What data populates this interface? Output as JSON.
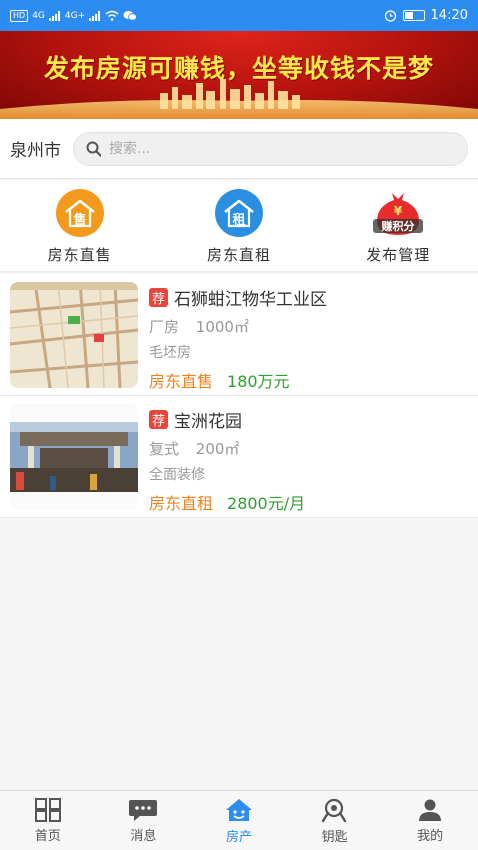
{
  "status_bar": {
    "time": "14:20",
    "network_a": "4G",
    "network_b": "4G+",
    "hd": "HD"
  },
  "banner": {
    "text": "发布房源可赚钱，坐等收钱不是梦"
  },
  "search": {
    "city": "泉州市",
    "placeholder": "搜索..."
  },
  "quick_nav": [
    {
      "label": "房东直售",
      "glyph": "售",
      "icon": "house-sale-icon",
      "color": "#f39a1c"
    },
    {
      "label": "房东直租",
      "glyph": "租",
      "icon": "house-rent-icon",
      "color": "#2a8fe0"
    },
    {
      "label": "发布管理",
      "glyph": "赚积分",
      "icon": "money-bag-icon",
      "color": "#e82b2b"
    }
  ],
  "listings": [
    {
      "badge": "荐",
      "title": "石狮蚶江物华工业区",
      "type": "厂房",
      "area": "1000㎡",
      "decoration": "毛坯房",
      "deal": "房东直售",
      "price": "180万元"
    },
    {
      "badge": "荐",
      "title": "宝洲花园",
      "type": "复式",
      "area": "200㎡",
      "decoration": "全面装修",
      "deal": "房东直租",
      "price": "2800元/月"
    }
  ],
  "tabs": [
    {
      "label": "首页",
      "icon": "grid-icon",
      "active": false
    },
    {
      "label": "消息",
      "icon": "message-icon",
      "active": false
    },
    {
      "label": "房产",
      "icon": "house-icon",
      "active": true
    },
    {
      "label": "钥匙",
      "icon": "key-search-icon",
      "active": false
    },
    {
      "label": "我的",
      "icon": "user-icon",
      "active": false
    }
  ],
  "colors": {
    "primary": "#2c8cf0",
    "price": "#2fa12c",
    "deal": "#f0821e",
    "badge": "#e8463b"
  }
}
